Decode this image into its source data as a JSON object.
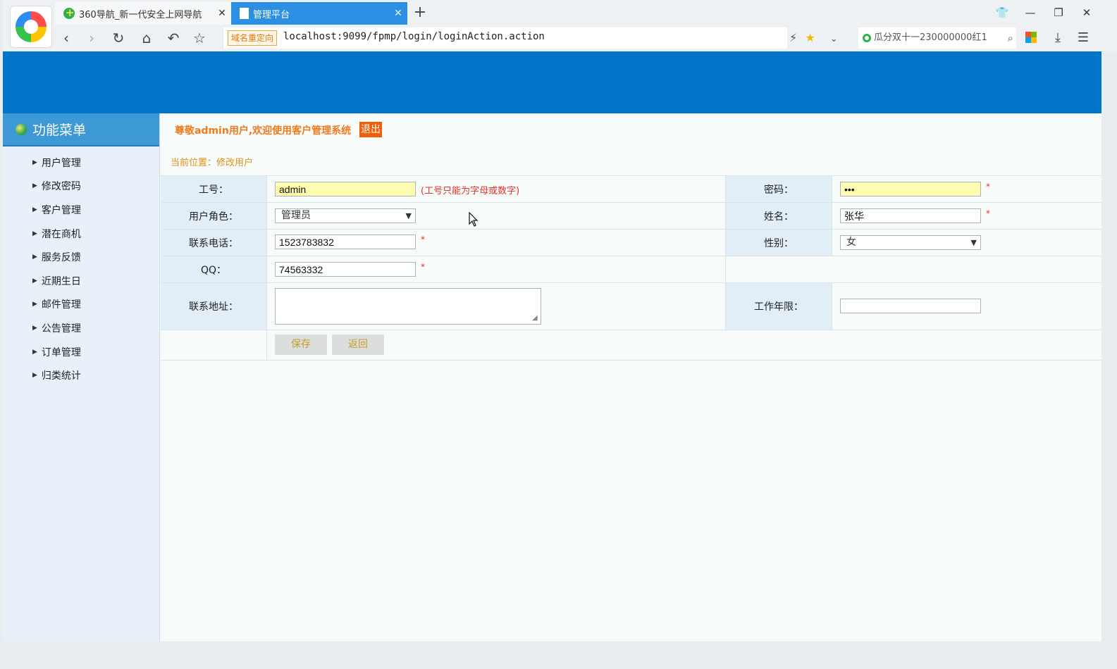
{
  "browser": {
    "tabs": [
      {
        "title": "360导航_新一代安全上网导航",
        "active": false
      },
      {
        "title": "管理平台",
        "active": true
      }
    ],
    "redirect_badge": "域名重定向",
    "url": "localhost:9099/fpmp/login/loginAction.action",
    "search_text": "瓜分双十一230000000红1"
  },
  "sidebar": {
    "title": "功能菜单",
    "items": [
      {
        "label": "用户管理"
      },
      {
        "label": "修改密码"
      },
      {
        "label": "客户管理"
      },
      {
        "label": "潜在商机"
      },
      {
        "label": "服务反馈"
      },
      {
        "label": "近期生日"
      },
      {
        "label": "邮件管理"
      },
      {
        "label": "公告管理"
      },
      {
        "label": "订单管理"
      },
      {
        "label": "归类统计"
      }
    ]
  },
  "header": {
    "welcome": "尊敬admin用户,欢迎使用客户管理系统",
    "logout": "退出"
  },
  "breadcrumb": {
    "label": "当前位置：修改用户"
  },
  "form": {
    "employee_id": {
      "label": "工号：",
      "value": "admin",
      "hint": "(工号只能为字母或数字)"
    },
    "password": {
      "label": "密码：",
      "value": "•••",
      "required": "*"
    },
    "role": {
      "label": "用户角色：",
      "value": "管理员"
    },
    "name": {
      "label": "姓名：",
      "value": "张华",
      "required": "*"
    },
    "phone": {
      "label": "联系电话：",
      "value": "1523783832",
      "required": "*"
    },
    "gender": {
      "label": "性别：",
      "value": "女"
    },
    "qq": {
      "label": "QQ：",
      "value": "74563332",
      "required": "*"
    },
    "address": {
      "label": "联系地址：",
      "value": ""
    },
    "work_years": {
      "label": "工作年限：",
      "value": ""
    },
    "save_label": "保存",
    "back_label": "返回"
  },
  "colors": {
    "banner": "#0075c8",
    "accent_orange": "#f07a1e",
    "required_red": "#e8322b",
    "input_highlight": "#fffbb0"
  }
}
